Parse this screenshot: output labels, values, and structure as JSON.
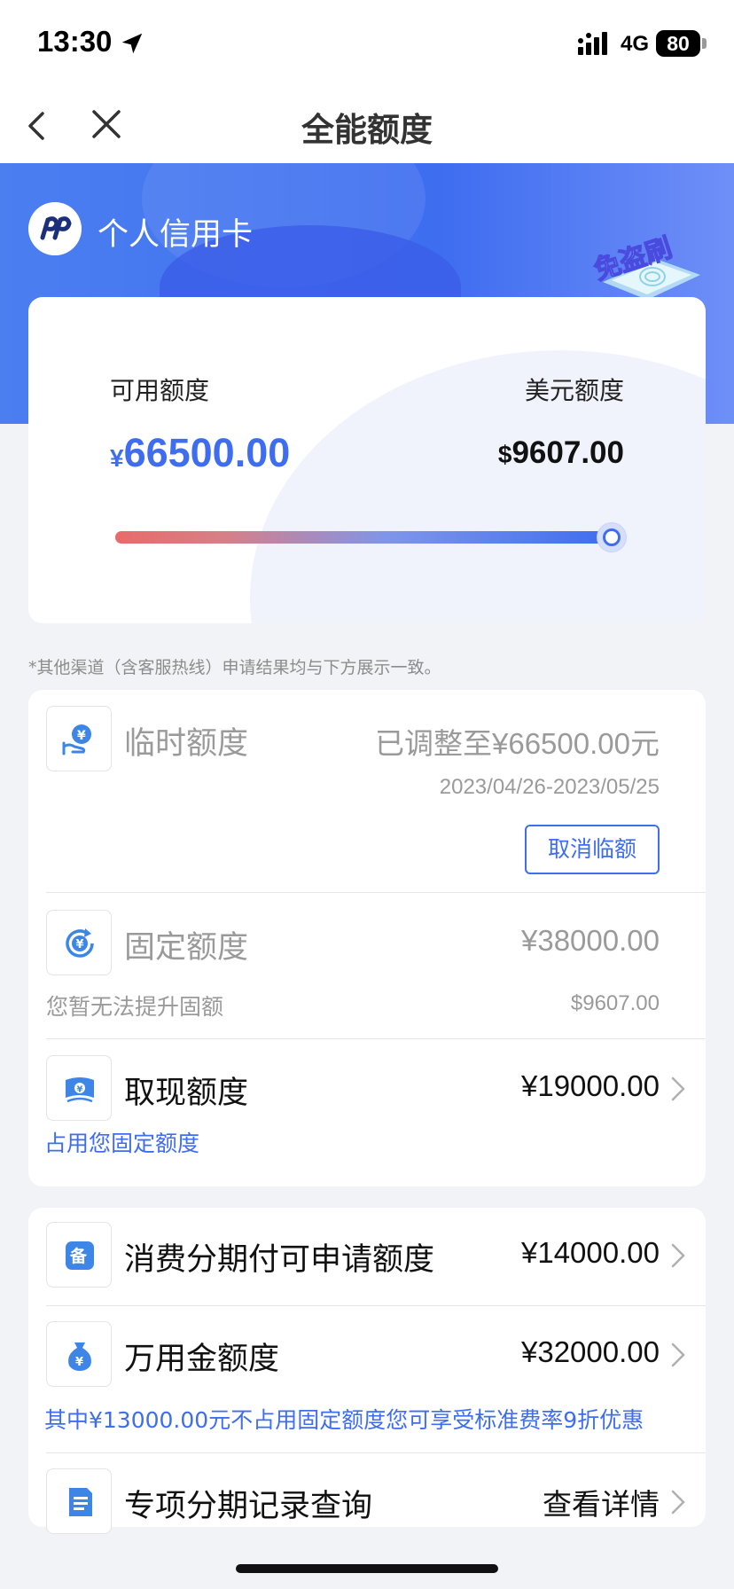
{
  "status_bar": {
    "time": "13:30",
    "network": "4G",
    "battery": "80"
  },
  "nav": {
    "title": "全能额度"
  },
  "hero": {
    "bank_name": "个人信用卡",
    "badge_text": "免盗刷"
  },
  "limit_card": {
    "available_label": "可用额度",
    "available_currency": "¥",
    "available_value": "66500.00",
    "usd_label": "美元额度",
    "usd_currency": "$",
    "usd_value": "9607.00",
    "slider_fraction": 1.0
  },
  "note": "*其他渠道（含客服热线）申请结果均与下方展示一致。",
  "temporary": {
    "title": "临时额度",
    "value": "已调整至¥66500.00元",
    "date_range": "2023/04/26-2023/05/25",
    "cancel_label": "取消临额",
    "icon": "yen-hand-icon"
  },
  "fixed": {
    "title": "固定额度",
    "value": "¥38000.00",
    "sub_text": "您暂无法提升固额",
    "usd_value": "$9607.00",
    "icon": "yen-refresh-icon"
  },
  "cash": {
    "title": "取现额度",
    "value": "¥19000.00",
    "sub_text": "占用您固定额度",
    "icon": "cash-note-icon"
  },
  "installment": {
    "title": "消费分期付可申请额度",
    "value": "¥14000.00",
    "icon": "bei-icon"
  },
  "wanyongjin": {
    "title": "万用金额度",
    "value": "¥32000.00",
    "sub_text": "其中¥13000.00元不占用固定额度您可享受标准费率9折优惠",
    "icon": "money-bag-icon"
  },
  "special": {
    "title": "专项分期记录查询",
    "value": "查看详情",
    "icon": "document-icon"
  },
  "colors": {
    "brand_blue": "#3e6df0",
    "slider_start": "#e96a6a"
  }
}
